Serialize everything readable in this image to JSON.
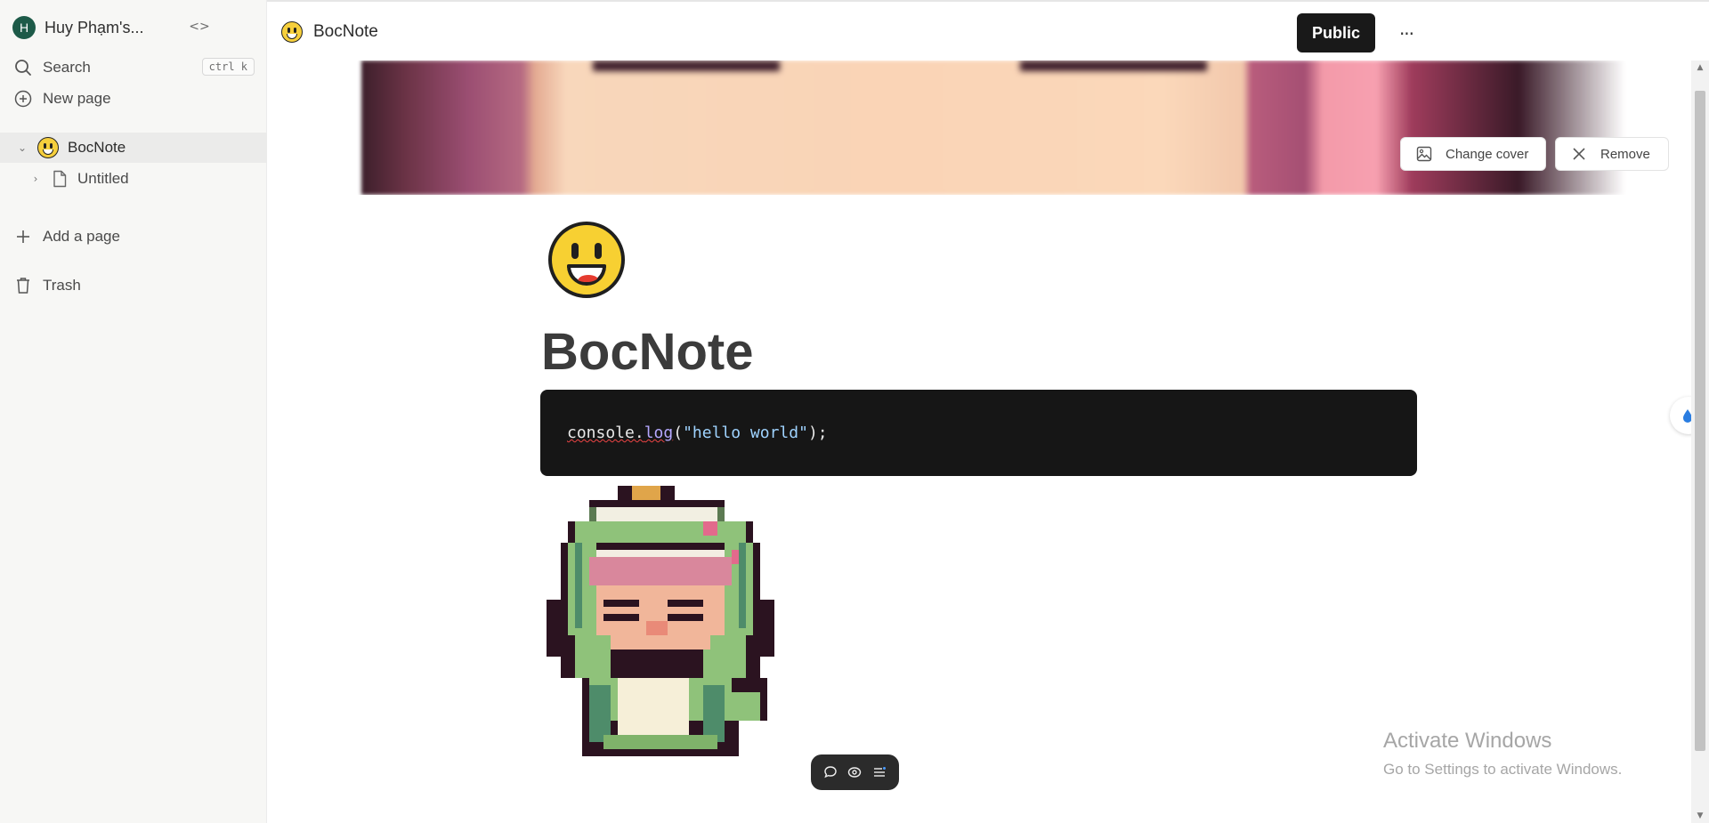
{
  "sidebar": {
    "workspace": {
      "avatar_letter": "H",
      "name": "Huy Phạm's..."
    },
    "search": {
      "label": "Search",
      "shortcut": "ctrl k"
    },
    "new_page": {
      "label": "New page"
    },
    "tree": [
      {
        "label": "BocNote",
        "icon": "smiley-emoji",
        "expanded": true
      },
      {
        "label": "Untitled",
        "icon": "page-icon",
        "expanded": false
      }
    ],
    "add_page": {
      "label": "Add a page"
    },
    "trash": {
      "label": "Trash"
    }
  },
  "topbar": {
    "title": "BocNote",
    "public_label": "Public",
    "more_label": "···"
  },
  "cover": {
    "change_label": "Change cover",
    "remove_label": "Remove"
  },
  "page": {
    "title": "BocNote",
    "emoji": "smiley-emoji",
    "code": {
      "obj": "console.",
      "method": "log",
      "open": "(",
      "string": "\"hello world\"",
      "close": ");"
    }
  },
  "watermark": {
    "line1": "Activate Windows",
    "line2": "Go to Settings to activate Windows."
  },
  "colors": {
    "avatar": "#1d5a48",
    "public_button": "#191919",
    "code_bg": "#161616",
    "code_method": "#b5a8ff",
    "code_string": "#9fd3ff"
  }
}
